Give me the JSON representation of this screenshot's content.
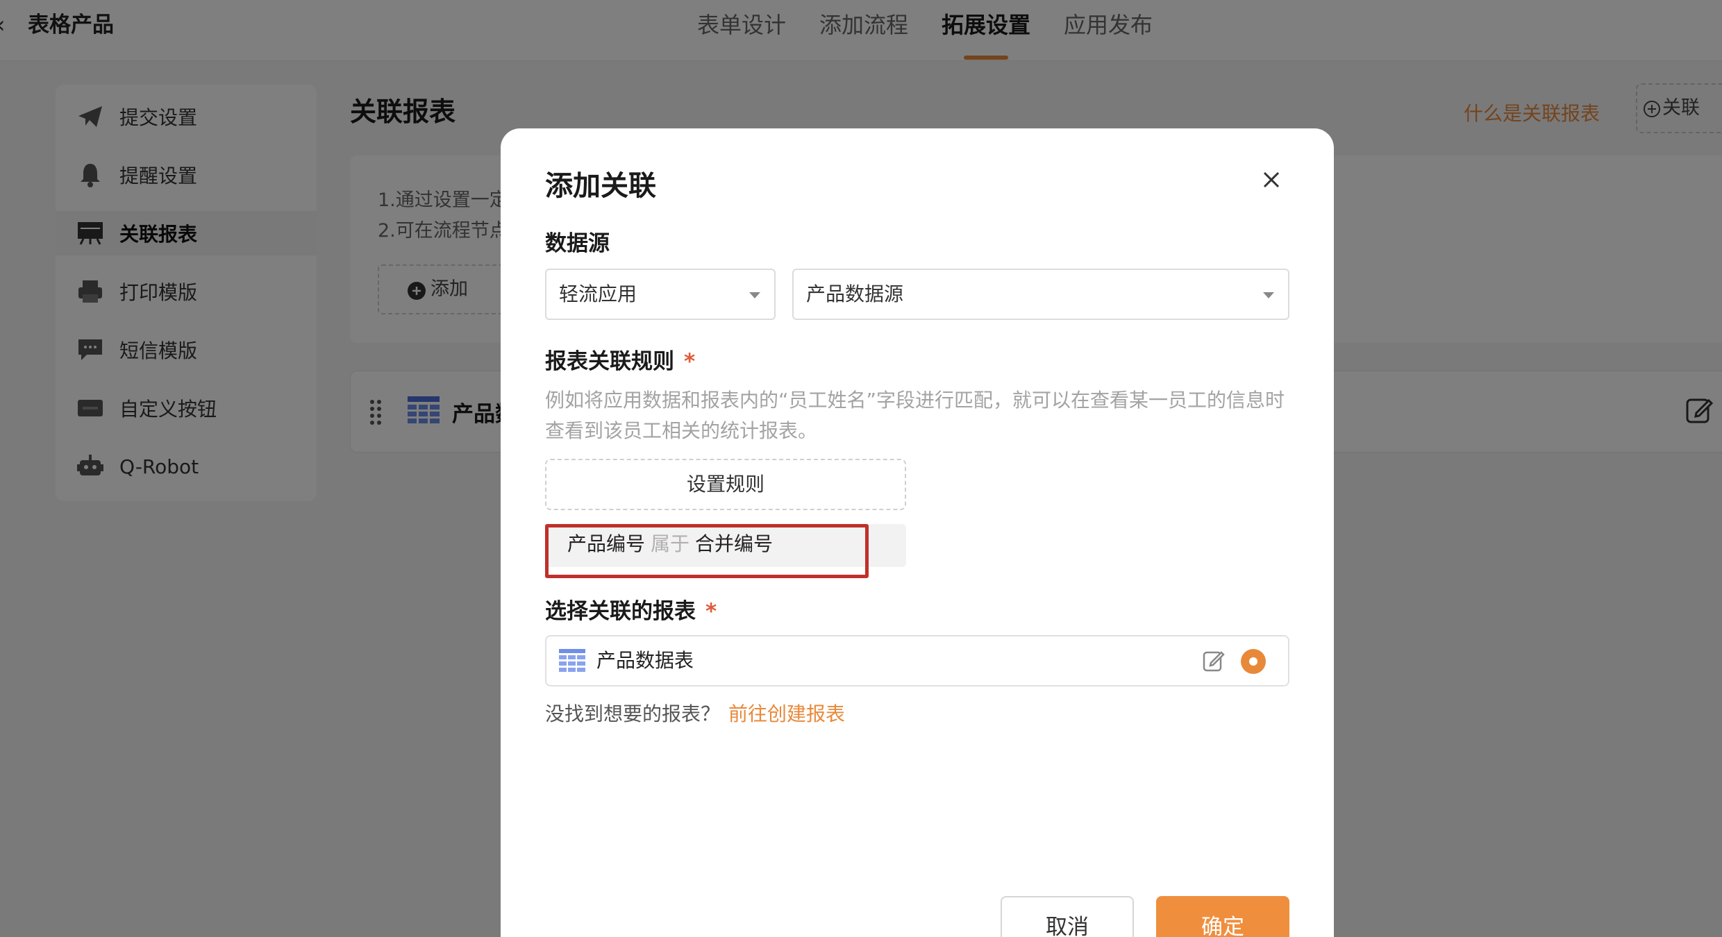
{
  "header": {
    "title": "表格产品",
    "tabs": [
      {
        "label": "表单设计"
      },
      {
        "label": "添加流程"
      },
      {
        "label": "拓展设置"
      },
      {
        "label": "应用发布"
      }
    ]
  },
  "sidebar": {
    "items": [
      {
        "label": "提交设置",
        "icon": "send-icon"
      },
      {
        "label": "提醒设置",
        "icon": "bell-icon"
      },
      {
        "label": "关联报表",
        "icon": "report-icon"
      },
      {
        "label": "打印模版",
        "icon": "printer-icon"
      },
      {
        "label": "短信模版",
        "icon": "message-icon"
      },
      {
        "label": "自定义按钮",
        "icon": "custom-button-icon"
      },
      {
        "label": "Q-Robot",
        "icon": "robot-icon"
      }
    ]
  },
  "main": {
    "title": "关联报表",
    "help_link": "什么是关联报表",
    "add_assoc_label": "关联",
    "info_line_1": "1.通过设置一定",
    "info_line_2": "2.可在流程节点",
    "add_label": "添加",
    "report_name": "产品数"
  },
  "modal": {
    "title": "添加关联",
    "datasource_label": "数据源",
    "source_app": "轻流应用",
    "source_data": "产品数据源",
    "rule_label": "报表关联规则",
    "required_mark": "*",
    "hint": "例如将应用数据和报表内的“员工姓名”字段进行匹配，就可以在查看某一员工的信息时查看到该员工相关的统计报表。",
    "set_rule_button": "设置规则",
    "rule": {
      "field": "产品编号",
      "operator": "属于",
      "target": "合并编号"
    },
    "report_label": "选择关联的报表",
    "selected_report": "产品数据表",
    "not_found_text": "没找到想要的报表？",
    "create_link": "前往创建报表",
    "cancel_button": "取消",
    "ok_button": "确定"
  },
  "colors": {
    "accent": "#e8893a",
    "highlight_border": "#c0302a"
  }
}
